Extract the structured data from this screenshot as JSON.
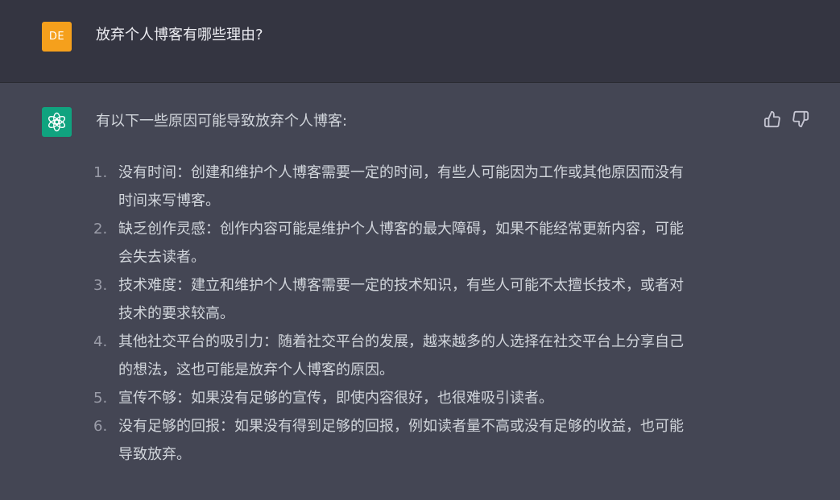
{
  "user": {
    "avatar_initials": "DE",
    "avatar_color": "#f5a01c",
    "question": "放弃个人博客有哪些理由?"
  },
  "assistant": {
    "avatar_icon": "openai-logo-icon",
    "avatar_color": "#10a37f",
    "intro": "有以下一些原因可能导致放弃个人博客:",
    "items": [
      {
        "num": "1.",
        "lines": [
          "没有时间：创建和维护个人博客需要一定的时间，有些人可能因为工作或其他原因而没有",
          "时间来写博客。"
        ]
      },
      {
        "num": "2.",
        "lines": [
          "缺乏创作灵感：创作内容可能是维护个人博客的最大障碍，如果不能经常更新内容，可能",
          "会失去读者。"
        ]
      },
      {
        "num": "3.",
        "lines": [
          "技术难度：建立和维护个人博客需要一定的技术知识，有些人可能不太擅长技术，或者对",
          "技术的要求较高。"
        ]
      },
      {
        "num": "4.",
        "lines": [
          "其他社交平台的吸引力：随着社交平台的发展，越来越多的人选择在社交平台上分享自己",
          "的想法，这也可能是放弃个人博客的原因。"
        ]
      },
      {
        "num": "5.",
        "lines": [
          "宣传不够：如果没有足够的宣传，即使内容很好，也很难吸引读者。"
        ]
      },
      {
        "num": "6.",
        "lines": [
          "没有足够的回报：如果没有得到足够的回报，例如读者量不高或没有足够的收益，也可能",
          "导致放弃。"
        ]
      }
    ]
  },
  "feedback": {
    "up_icon": "thumbs-up-icon",
    "down_icon": "thumbs-down-icon"
  },
  "colors": {
    "user_bg": "#343541",
    "assistant_bg": "#444654",
    "text": "#d1d5db"
  }
}
